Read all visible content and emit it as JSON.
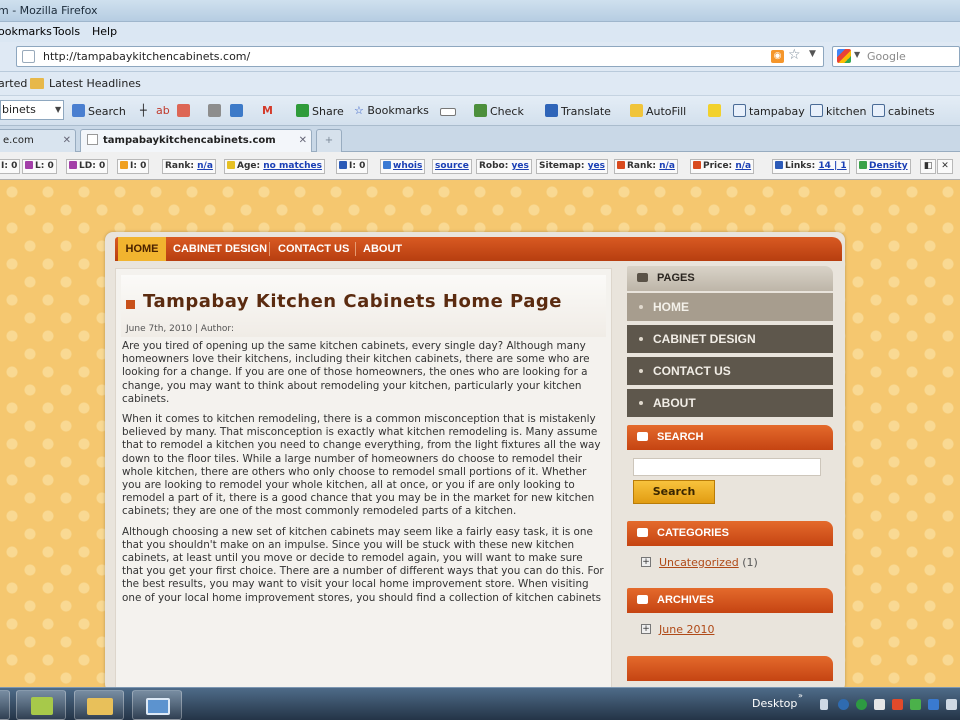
{
  "window": {
    "title": "m - Mozilla Firefox"
  },
  "menu": {
    "bookmarks": "ookmarks",
    "tools": "Tools",
    "help": "Help"
  },
  "nav": {
    "url": "http://tampabaykitchencabinets.com/",
    "search_placeholder": "Google"
  },
  "bookmarks_bar": {
    "item0": "arted",
    "item1": "Latest Headlines"
  },
  "toolbar": {
    "select_value": "binets",
    "search": "Search",
    "share": "Share",
    "bookmarks": "Bookmarks",
    "check": "Check",
    "translate": "Translate",
    "autofill": "AutoFill",
    "kw1": "tampabay",
    "kw2": "kitchen",
    "kw3": "cabinets"
  },
  "tabs": [
    {
      "label": "e.com"
    },
    {
      "label": "tampabaykitchencabinets.com"
    }
  ],
  "seobar": {
    "i1": "I: 0",
    "l": "L: 0",
    "ld": "LD: 0",
    "i2": "I: 0",
    "rank_label": "Rank:",
    "rank_val": "n/a",
    "age_label": "Age:",
    "age_val": "no matches",
    "i3": "I: 0",
    "whois": "whois",
    "source": "source",
    "robo_label": "Robo:",
    "robo_val": "yes",
    "sitemap_label": "Sitemap:",
    "sitemap_val": "yes",
    "rank2_label": "Rank:",
    "rank2_val": "n/a",
    "price_label": "Price:",
    "price_val": "n/a",
    "links_label": "Links:",
    "links_val": "14 | 1",
    "density": "Density"
  },
  "site": {
    "nav": [
      "HOME",
      "CABINET DESIGN",
      "CONTACT US",
      "ABOUT"
    ],
    "post": {
      "title": "Tampabay Kitchen Cabinets Home Page",
      "meta": "June 7th, 2010 | Author:",
      "p1": "Are you tired of opening up the same kitchen cabinets, every single day? Although many homeowners love their kitchens, including their kitchen cabinets, there are some who are looking for a change.  If you are one of those homeowners, the ones who are looking for a change, you may want to think about remodeling your kitchen, particularly your kitchen cabinets.",
      "p2": "When it comes to kitchen remodeling, there is a common misconception that is mistakenly believed by many. That misconception is exactly what kitchen remodeling is. Many assume that to remodel a kitchen you need to change everything, from the light fixtures all the way down to the floor tiles.  While a large number of homeowners do choose to remodel their whole kitchen, there are others who only choose to remodel small portions of it.  Whether you are looking to remodel your whole kitchen, all at once, or you if are only looking to remodel a part of it, there is a good chance that you may be in the market for new kitchen cabinets; they are one of the most commonly remodeled parts of a kitchen.",
      "p3": "Although choosing a new set of kitchen cabinets may seem like a fairly easy task, it is one that you shouldn't make on an impulse.  Since you will be stuck with these new kitchen cabinets, at least until you move or decide to remodel again, you will want to make sure that you get your first choice.  There are a number of different ways that you can do this. For the best results, you may want to visit your local home improvement store.  When visiting one of your local home improvement stores, you should find a collection of kitchen cabinets"
    },
    "sidebar": {
      "pages_title": "PAGES",
      "pages": [
        "HOME",
        "CABINET DESIGN",
        "CONTACT US",
        "ABOUT"
      ],
      "search_title": "SEARCH",
      "search_button": "Search",
      "categories_title": "CATEGORIES",
      "category_link": "Uncategorized",
      "category_count": "(1)",
      "archives_title": "ARCHIVES",
      "archive_link": "June 2010"
    }
  },
  "taskbar": {
    "desktop": "Desktop"
  }
}
